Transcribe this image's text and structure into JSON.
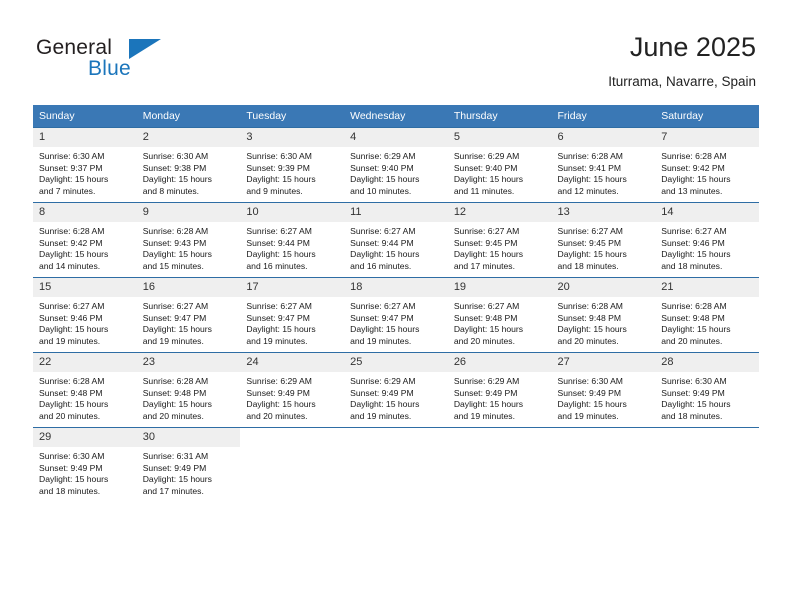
{
  "brand": {
    "name_part1": "General",
    "name_part2": "Blue",
    "flag_icon": "triangle-flag-icon"
  },
  "header": {
    "title": "June 2025",
    "location": "Iturrama, Navarre, Spain"
  },
  "colors": {
    "header_row": "#3a78b5",
    "row_divider": "#2e6da4",
    "daynum_band": "#efefef",
    "brand_blue": "#1b75bb"
  },
  "weekdays": [
    "Sunday",
    "Monday",
    "Tuesday",
    "Wednesday",
    "Thursday",
    "Friday",
    "Saturday"
  ],
  "weeks": [
    [
      {
        "day": "1",
        "sunrise": "Sunrise: 6:30 AM",
        "sunset": "Sunset: 9:37 PM",
        "daylight1": "Daylight: 15 hours",
        "daylight2": "and 7 minutes."
      },
      {
        "day": "2",
        "sunrise": "Sunrise: 6:30 AM",
        "sunset": "Sunset: 9:38 PM",
        "daylight1": "Daylight: 15 hours",
        "daylight2": "and 8 minutes."
      },
      {
        "day": "3",
        "sunrise": "Sunrise: 6:30 AM",
        "sunset": "Sunset: 9:39 PM",
        "daylight1": "Daylight: 15 hours",
        "daylight2": "and 9 minutes."
      },
      {
        "day": "4",
        "sunrise": "Sunrise: 6:29 AM",
        "sunset": "Sunset: 9:40 PM",
        "daylight1": "Daylight: 15 hours",
        "daylight2": "and 10 minutes."
      },
      {
        "day": "5",
        "sunrise": "Sunrise: 6:29 AM",
        "sunset": "Sunset: 9:40 PM",
        "daylight1": "Daylight: 15 hours",
        "daylight2": "and 11 minutes."
      },
      {
        "day": "6",
        "sunrise": "Sunrise: 6:28 AM",
        "sunset": "Sunset: 9:41 PM",
        "daylight1": "Daylight: 15 hours",
        "daylight2": "and 12 minutes."
      },
      {
        "day": "7",
        "sunrise": "Sunrise: 6:28 AM",
        "sunset": "Sunset: 9:42 PM",
        "daylight1": "Daylight: 15 hours",
        "daylight2": "and 13 minutes."
      }
    ],
    [
      {
        "day": "8",
        "sunrise": "Sunrise: 6:28 AM",
        "sunset": "Sunset: 9:42 PM",
        "daylight1": "Daylight: 15 hours",
        "daylight2": "and 14 minutes."
      },
      {
        "day": "9",
        "sunrise": "Sunrise: 6:28 AM",
        "sunset": "Sunset: 9:43 PM",
        "daylight1": "Daylight: 15 hours",
        "daylight2": "and 15 minutes."
      },
      {
        "day": "10",
        "sunrise": "Sunrise: 6:27 AM",
        "sunset": "Sunset: 9:44 PM",
        "daylight1": "Daylight: 15 hours",
        "daylight2": "and 16 minutes."
      },
      {
        "day": "11",
        "sunrise": "Sunrise: 6:27 AM",
        "sunset": "Sunset: 9:44 PM",
        "daylight1": "Daylight: 15 hours",
        "daylight2": "and 16 minutes."
      },
      {
        "day": "12",
        "sunrise": "Sunrise: 6:27 AM",
        "sunset": "Sunset: 9:45 PM",
        "daylight1": "Daylight: 15 hours",
        "daylight2": "and 17 minutes."
      },
      {
        "day": "13",
        "sunrise": "Sunrise: 6:27 AM",
        "sunset": "Sunset: 9:45 PM",
        "daylight1": "Daylight: 15 hours",
        "daylight2": "and 18 minutes."
      },
      {
        "day": "14",
        "sunrise": "Sunrise: 6:27 AM",
        "sunset": "Sunset: 9:46 PM",
        "daylight1": "Daylight: 15 hours",
        "daylight2": "and 18 minutes."
      }
    ],
    [
      {
        "day": "15",
        "sunrise": "Sunrise: 6:27 AM",
        "sunset": "Sunset: 9:46 PM",
        "daylight1": "Daylight: 15 hours",
        "daylight2": "and 19 minutes."
      },
      {
        "day": "16",
        "sunrise": "Sunrise: 6:27 AM",
        "sunset": "Sunset: 9:47 PM",
        "daylight1": "Daylight: 15 hours",
        "daylight2": "and 19 minutes."
      },
      {
        "day": "17",
        "sunrise": "Sunrise: 6:27 AM",
        "sunset": "Sunset: 9:47 PM",
        "daylight1": "Daylight: 15 hours",
        "daylight2": "and 19 minutes."
      },
      {
        "day": "18",
        "sunrise": "Sunrise: 6:27 AM",
        "sunset": "Sunset: 9:47 PM",
        "daylight1": "Daylight: 15 hours",
        "daylight2": "and 19 minutes."
      },
      {
        "day": "19",
        "sunrise": "Sunrise: 6:27 AM",
        "sunset": "Sunset: 9:48 PM",
        "daylight1": "Daylight: 15 hours",
        "daylight2": "and 20 minutes."
      },
      {
        "day": "20",
        "sunrise": "Sunrise: 6:28 AM",
        "sunset": "Sunset: 9:48 PM",
        "daylight1": "Daylight: 15 hours",
        "daylight2": "and 20 minutes."
      },
      {
        "day": "21",
        "sunrise": "Sunrise: 6:28 AM",
        "sunset": "Sunset: 9:48 PM",
        "daylight1": "Daylight: 15 hours",
        "daylight2": "and 20 minutes."
      }
    ],
    [
      {
        "day": "22",
        "sunrise": "Sunrise: 6:28 AM",
        "sunset": "Sunset: 9:48 PM",
        "daylight1": "Daylight: 15 hours",
        "daylight2": "and 20 minutes."
      },
      {
        "day": "23",
        "sunrise": "Sunrise: 6:28 AM",
        "sunset": "Sunset: 9:48 PM",
        "daylight1": "Daylight: 15 hours",
        "daylight2": "and 20 minutes."
      },
      {
        "day": "24",
        "sunrise": "Sunrise: 6:29 AM",
        "sunset": "Sunset: 9:49 PM",
        "daylight1": "Daylight: 15 hours",
        "daylight2": "and 20 minutes."
      },
      {
        "day": "25",
        "sunrise": "Sunrise: 6:29 AM",
        "sunset": "Sunset: 9:49 PM",
        "daylight1": "Daylight: 15 hours",
        "daylight2": "and 19 minutes."
      },
      {
        "day": "26",
        "sunrise": "Sunrise: 6:29 AM",
        "sunset": "Sunset: 9:49 PM",
        "daylight1": "Daylight: 15 hours",
        "daylight2": "and 19 minutes."
      },
      {
        "day": "27",
        "sunrise": "Sunrise: 6:30 AM",
        "sunset": "Sunset: 9:49 PM",
        "daylight1": "Daylight: 15 hours",
        "daylight2": "and 19 minutes."
      },
      {
        "day": "28",
        "sunrise": "Sunrise: 6:30 AM",
        "sunset": "Sunset: 9:49 PM",
        "daylight1": "Daylight: 15 hours",
        "daylight2": "and 18 minutes."
      }
    ],
    [
      {
        "day": "29",
        "sunrise": "Sunrise: 6:30 AM",
        "sunset": "Sunset: 9:49 PM",
        "daylight1": "Daylight: 15 hours",
        "daylight2": "and 18 minutes."
      },
      {
        "day": "30",
        "sunrise": "Sunrise: 6:31 AM",
        "sunset": "Sunset: 9:49 PM",
        "daylight1": "Daylight: 15 hours",
        "daylight2": "and 17 minutes."
      },
      {
        "day": "",
        "sunrise": "",
        "sunset": "",
        "daylight1": "",
        "daylight2": ""
      },
      {
        "day": "",
        "sunrise": "",
        "sunset": "",
        "daylight1": "",
        "daylight2": ""
      },
      {
        "day": "",
        "sunrise": "",
        "sunset": "",
        "daylight1": "",
        "daylight2": ""
      },
      {
        "day": "",
        "sunrise": "",
        "sunset": "",
        "daylight1": "",
        "daylight2": ""
      },
      {
        "day": "",
        "sunrise": "",
        "sunset": "",
        "daylight1": "",
        "daylight2": ""
      }
    ]
  ]
}
